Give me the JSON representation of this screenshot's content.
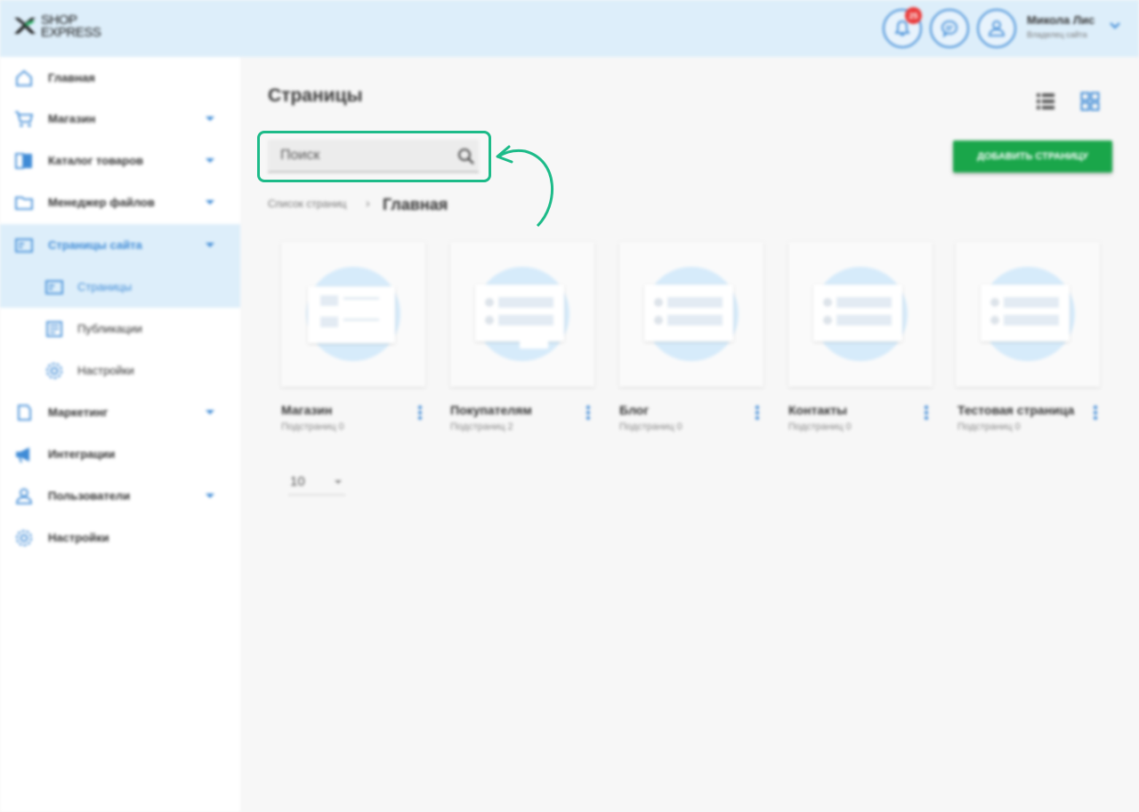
{
  "app": {
    "logo_line1": "SHOP",
    "logo_line2": "EXPRESS"
  },
  "header": {
    "notifications_count": "25",
    "user_name": "Микола Лис",
    "user_role": "Владелец сайта"
  },
  "sidebar": {
    "items": [
      {
        "label": "Главная",
        "icon": "home-icon"
      },
      {
        "label": "Магазин",
        "icon": "cart-icon",
        "expandable": true
      },
      {
        "label": "Каталог товаров",
        "icon": "book-icon",
        "expandable": true
      },
      {
        "label": "Менеджер файлов",
        "icon": "folder-icon",
        "expandable": true
      },
      {
        "label": "Страницы сайта",
        "icon": "page-icon",
        "expandable": true,
        "active": true
      },
      {
        "label": "Маркетинг",
        "icon": "marketing-icon",
        "expandable": true
      },
      {
        "label": "Интеграции",
        "icon": "megaphone-icon"
      },
      {
        "label": "Пользователи",
        "icon": "users-icon",
        "expandable": true
      },
      {
        "label": "Настройки",
        "icon": "gear-icon"
      }
    ],
    "subitems": [
      {
        "label": "Страницы",
        "icon": "page-icon",
        "active": true
      },
      {
        "label": "Публикации",
        "icon": "newspaper-icon"
      },
      {
        "label": "Настройки",
        "icon": "gear-icon"
      }
    ]
  },
  "main": {
    "title": "Страницы",
    "search_placeholder": "Поиск",
    "add_button": "ДОБАВИТЬ СТРАНИЦУ",
    "breadcrumb_root": "Список страниц",
    "breadcrumb_current": "Главная",
    "cards": [
      {
        "name": "Магазин",
        "sub": "Подстраниц 0"
      },
      {
        "name": "Покупателям",
        "sub": "Подстраниц 2"
      },
      {
        "name": "Блог",
        "sub": "Подстраниц 0"
      },
      {
        "name": "Контакты",
        "sub": "Подстраниц 0"
      },
      {
        "name": "Тестовая страница",
        "sub": "Подстраниц 0"
      }
    ],
    "per_page": "10"
  },
  "colors": {
    "accent": "#3f8bd6",
    "header_bg": "#ddeefa",
    "add_button": "#1aa64a",
    "highlight": "#1dbb89",
    "badge": "#ea3a3a"
  }
}
